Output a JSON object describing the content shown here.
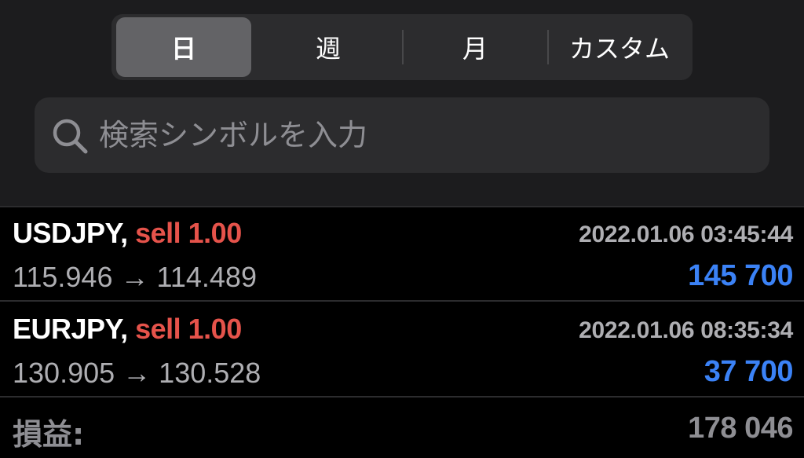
{
  "period_tabs": [
    {
      "label": "日",
      "active": true
    },
    {
      "label": "週",
      "active": false
    },
    {
      "label": "月",
      "active": false
    },
    {
      "label": "カスタム",
      "active": false
    }
  ],
  "search": {
    "placeholder": "検索シンボルを入力",
    "value": ""
  },
  "trades": [
    {
      "symbol": "USDJPY,",
      "side": "sell",
      "volume": "1.00",
      "time": "2022.01.06 03:45:44",
      "open_price": "115.946",
      "arrow": "→",
      "close_price": "114.489",
      "profit": "145 700"
    },
    {
      "symbol": "EURJPY,",
      "side": "sell",
      "volume": "1.00",
      "time": "2022.01.06 08:35:34",
      "open_price": "130.905",
      "arrow": "→",
      "close_price": "130.528",
      "profit": "37 700"
    }
  ],
  "summary": {
    "label": "損益:",
    "value": "178 046"
  },
  "colors": {
    "sell": "#e5534b",
    "profit_positive": "#3b82f6",
    "muted_text": "#aeaeb2"
  }
}
